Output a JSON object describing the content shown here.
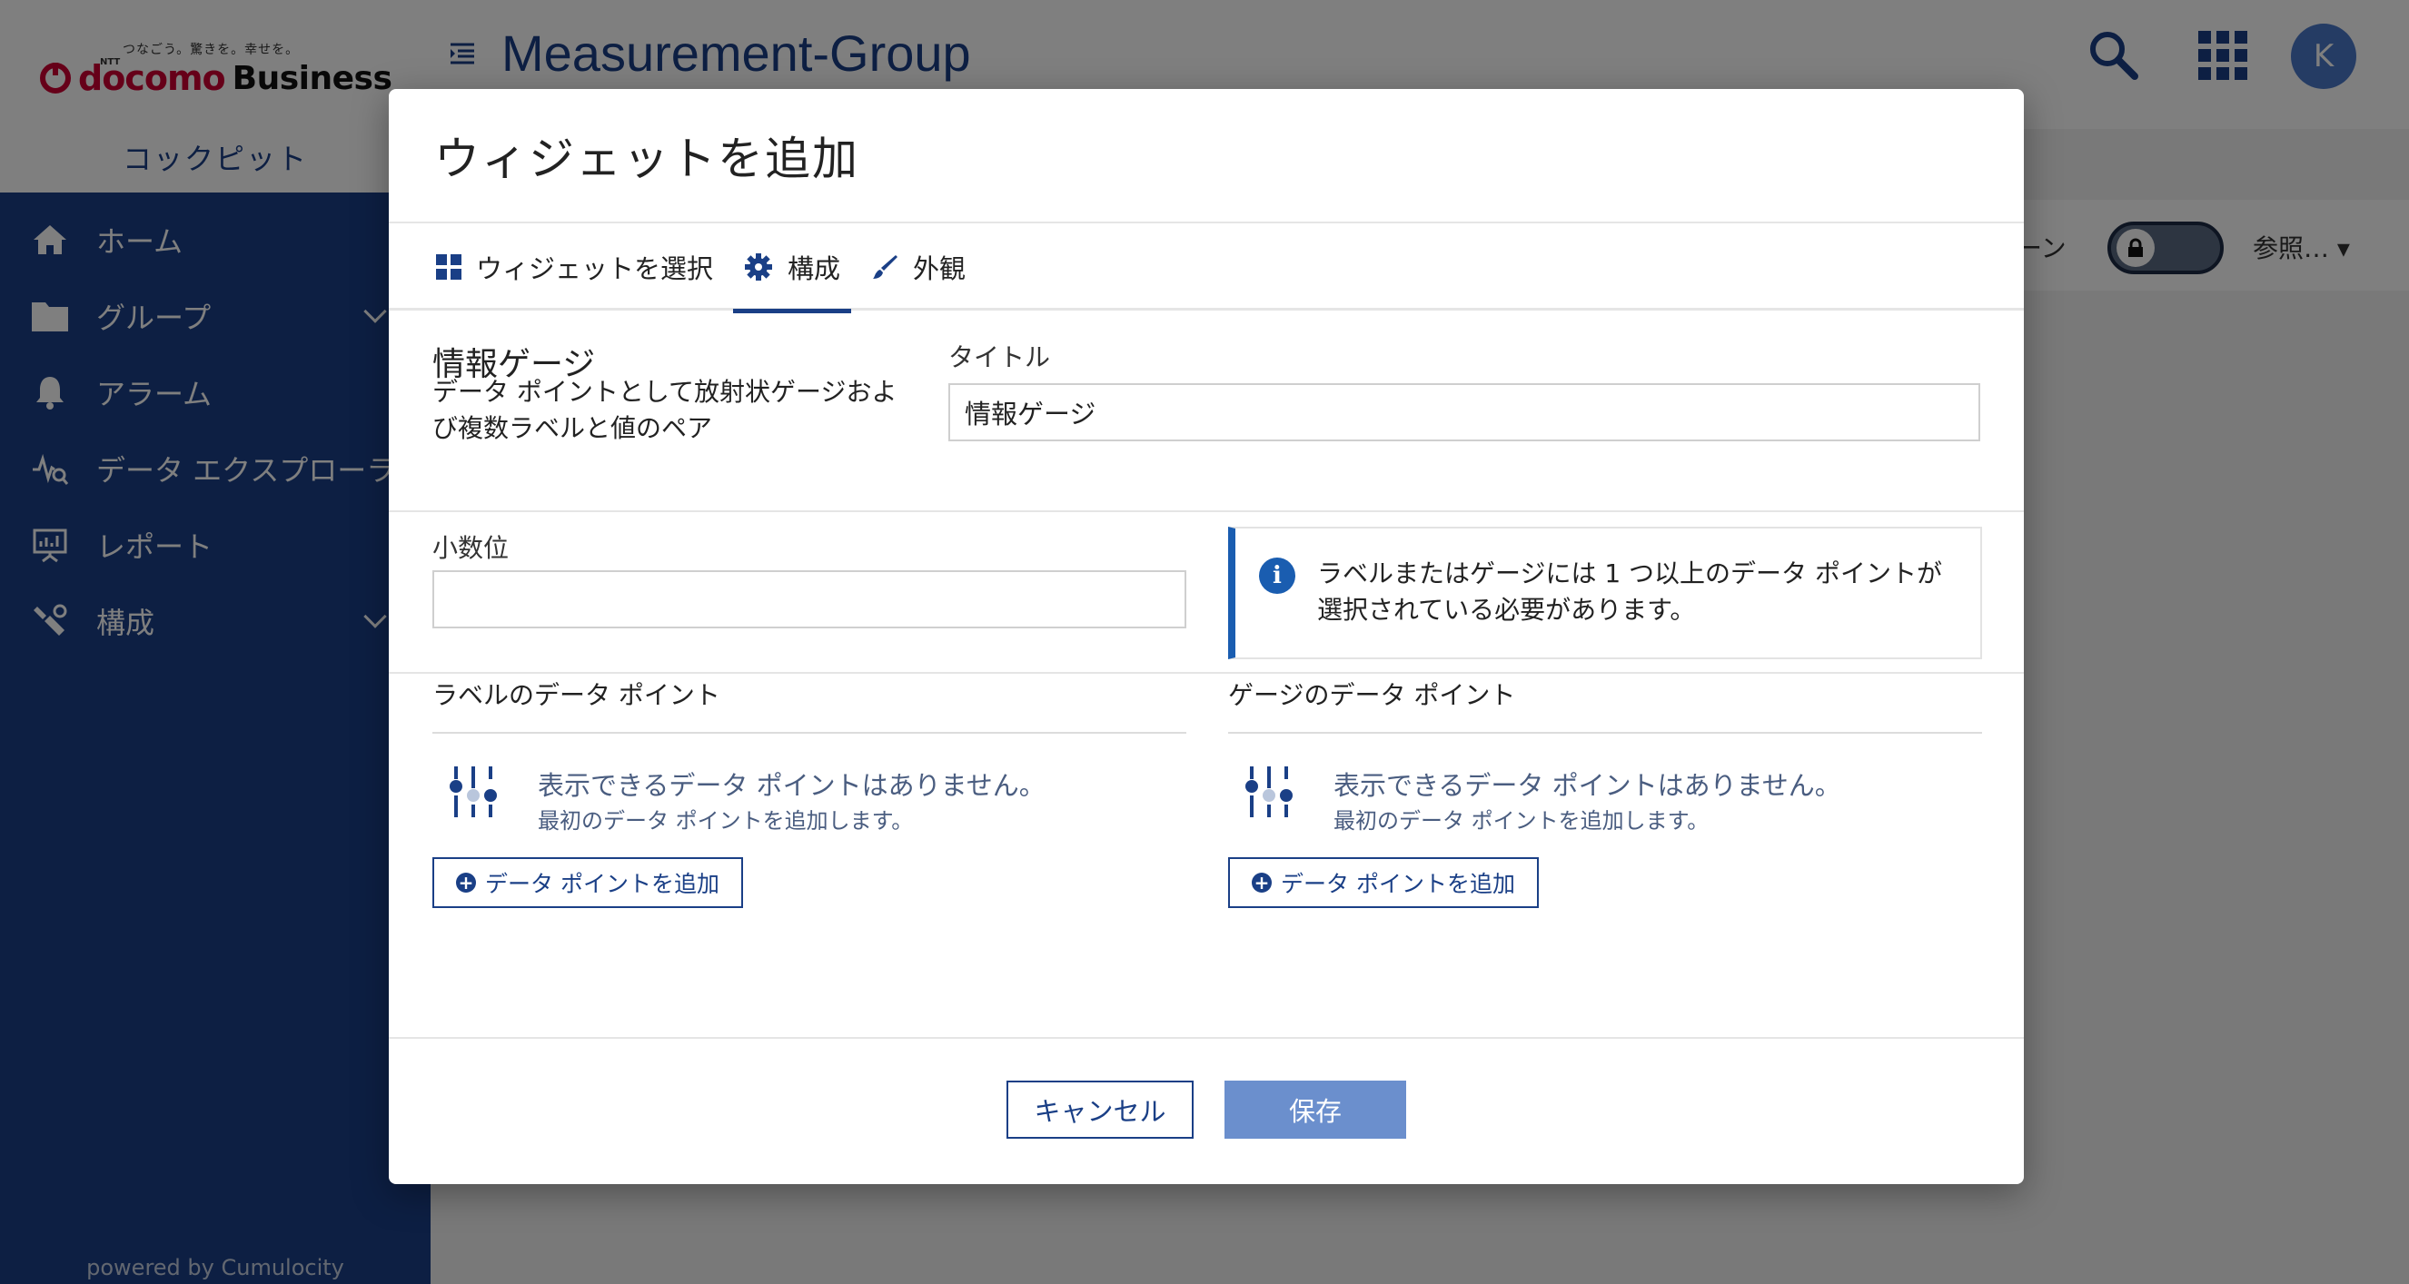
{
  "app": {
    "brand_tagline": "つなごう。驚きを。幸せを。",
    "brand_sub": "NTT",
    "brand_name_red": "docomo",
    "brand_name_dark": "Business",
    "section": "コックピット",
    "page_title": "Measurement-Group",
    "avatar_initial": "K",
    "powered_by": "powered by Cumulocity",
    "nav": [
      {
        "label": "ホーム",
        "icon": "home-icon"
      },
      {
        "label": "グループ",
        "icon": "folder-icon",
        "expandable": true
      },
      {
        "label": "アラーム",
        "icon": "bell-icon"
      },
      {
        "label": "データ エクスプローラ",
        "icon": "data-explorer-icon"
      },
      {
        "label": "レポート",
        "icon": "report-icon"
      },
      {
        "label": "構成",
        "icon": "wrench-icon",
        "expandable": true
      }
    ],
    "action_partial": "ーン",
    "view_label": "参照…"
  },
  "modal": {
    "title": "ウィジェットを追加",
    "tabs": [
      {
        "label": "ウィジェットを選択",
        "icon": "grid-icon"
      },
      {
        "label": "構成",
        "icon": "gear-icon",
        "active": true
      },
      {
        "label": "外観",
        "icon": "brush-icon"
      }
    ],
    "widget": {
      "name": "情報ゲージ",
      "description": "データ ポイントとして放射状ゲージおよび複数ラベルと値のペア"
    },
    "title_field": {
      "label": "タイトル",
      "value": "情報ゲージ"
    },
    "decimal_field": {
      "label": "小数位",
      "value": ""
    },
    "info_message": "ラベルまたはゲージには 1 つ以上のデータ ポイントが選択されている必要があります。",
    "label_dp": {
      "title": "ラベルのデータ ポイント",
      "empty_title": "表示できるデータ ポイントはありません。",
      "empty_sub": "最初のデータ ポイントを追加します。",
      "add_button": "データ ポイントを追加"
    },
    "gauge_dp": {
      "title": "ゲージのデータ ポイント",
      "empty_title": "表示できるデータ ポイントはありません。",
      "empty_sub": "最初のデータ ポイントを追加します。",
      "add_button": "データ ポイントを追加"
    },
    "cancel": "キャンセル",
    "save": "保存"
  },
  "colors": {
    "primary": "#1a3f86",
    "save_disabled": "#6b8fcd",
    "info": "#1a5db0"
  }
}
